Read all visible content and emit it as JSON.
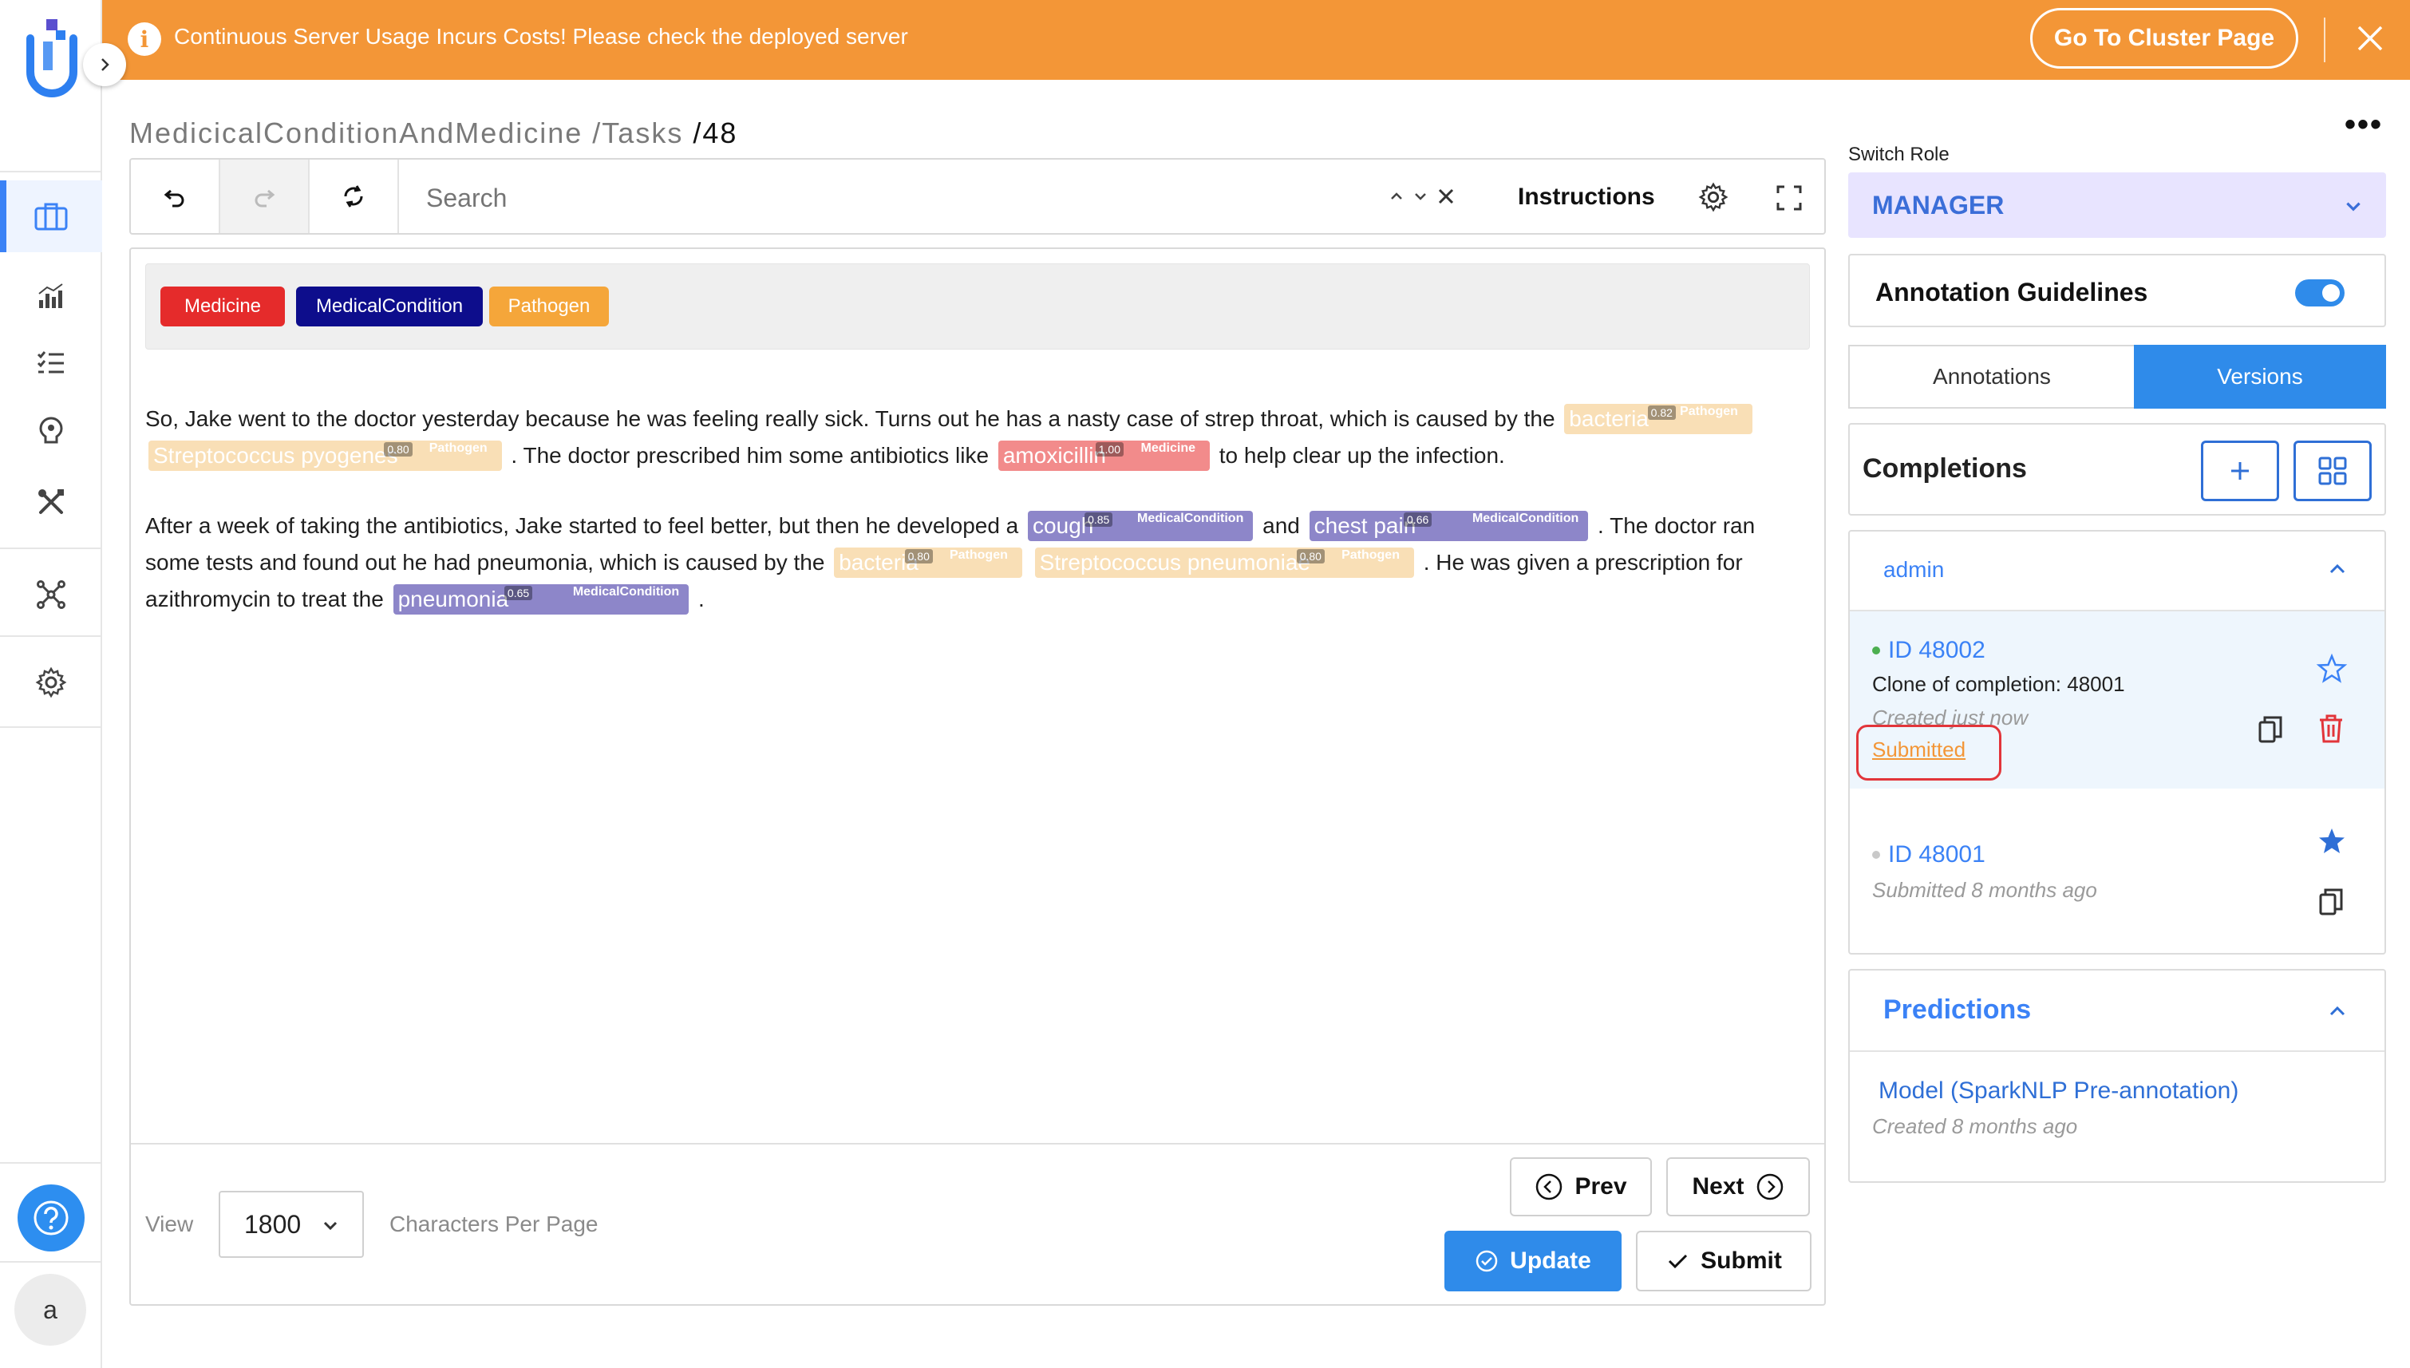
{
  "banner": {
    "message": "Continuous Server Usage Incurs Costs! Please check the deployed server",
    "button": "Go To Cluster Page",
    "color": "#f39637"
  },
  "breadcrumb": {
    "project": "MedicicalConditionAndMedicine",
    "tasks": "/Tasks",
    "sep": "/",
    "task_id": "48"
  },
  "toolbar": {
    "search_placeholder": "Search",
    "instructions": "Instructions"
  },
  "labels": [
    {
      "name": "Medicine",
      "color": "#e52b2b"
    },
    {
      "name": "MedicalCondition",
      "color": "#0d0d8c"
    },
    {
      "name": "Pathogen",
      "color": "#f5a63a"
    }
  ],
  "text": {
    "p1_a": "So, Jake went to the doctor yesterday because he was feeling really sick. Turns out he has a nasty case of strep throat, which is caused by the",
    "p1_b": ". The doctor prescribed him some antibiotics like",
    "p1_c": "to help clear up the infection.",
    "p2_a": "After a week of taking the antibiotics, Jake started to feel better, but then he developed a",
    "p2_b": "and",
    "p2_c": ". The doctor ran some tests and found out he had pneumonia, which is caused by the",
    "p2_d": ". He was given a prescription for azithromycin to treat the",
    "p2_e": "."
  },
  "entities": {
    "e1": {
      "text": "bacteria",
      "score": "0.82",
      "label": "Pathogen"
    },
    "e2": {
      "text": "Streptococcus pyogenes",
      "score": "0.80",
      "label": "Pathogen"
    },
    "e3": {
      "text": "amoxicillin",
      "score": "1.00",
      "label": "Medicine"
    },
    "e4": {
      "text": "cough",
      "score": "0.85",
      "label": "MedicalCondition"
    },
    "e5": {
      "text": "chest pain",
      "score": "0.66",
      "label": "MedicalCondition"
    },
    "e6": {
      "text": "bacteria",
      "score": "0.80",
      "label": "Pathogen"
    },
    "e7": {
      "text": "Streptococcus pneumoniae",
      "score": "0.80",
      "label": "Pathogen"
    },
    "e8": {
      "text": "pneumonia",
      "score": "0.65",
      "label": "MedicalCondition"
    }
  },
  "footer": {
    "view_label": "View",
    "chars_per_page": "1800",
    "cpp_label": "Characters Per Page",
    "prev": "Prev",
    "next": "Next",
    "update": "Update",
    "submit": "Submit"
  },
  "right": {
    "switch_role_label": "Switch Role",
    "role": "MANAGER",
    "guidelines": "Annotation Guidelines",
    "guidelines_enabled": true,
    "tabs": [
      "Annotations",
      "Versions"
    ],
    "active_tab": "Versions",
    "completions_title": "Completions",
    "group": "admin",
    "completions": [
      {
        "id": "ID 48002",
        "subtitle": "Clone of completion: 48001",
        "created": "Created just now",
        "status": "Submitted",
        "starred": false
      },
      {
        "id": "ID 48001",
        "created": "Submitted 8 months ago",
        "starred": true
      }
    ],
    "predictions_title": "Predictions",
    "prediction": {
      "name": "Model (SparkNLP Pre-annotation)",
      "created": "Created 8 months ago"
    }
  },
  "avatar_letter": "a"
}
